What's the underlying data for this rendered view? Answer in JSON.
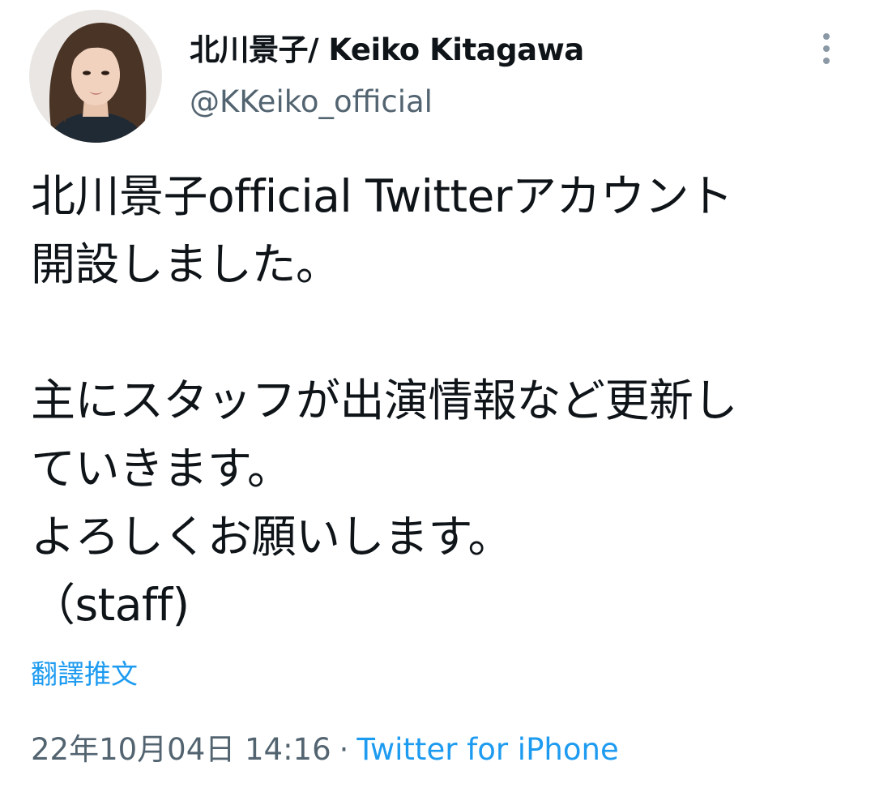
{
  "tweet": {
    "author": {
      "display_name": "北川景子/ Keiko Kitagawa",
      "handle": "@KKeiko_official"
    },
    "text_lines": [
      "北川景子official Twitterアカウント",
      "開設しました。",
      "",
      "主にスタッフが出演情報など更新し",
      "ていきます。",
      "よろしくお願いします。",
      "（staff)"
    ],
    "translate_label": "翻譯推文",
    "timestamp": "22年10月04日 14:16",
    "separator": "·",
    "source": "Twitter for iPhone"
  },
  "icons": {
    "more": "more-vertical-icon",
    "avatar": "profile-photo"
  },
  "colors": {
    "text": "#0f1419",
    "secondary": "#536471",
    "link": "#1d9bf0"
  }
}
